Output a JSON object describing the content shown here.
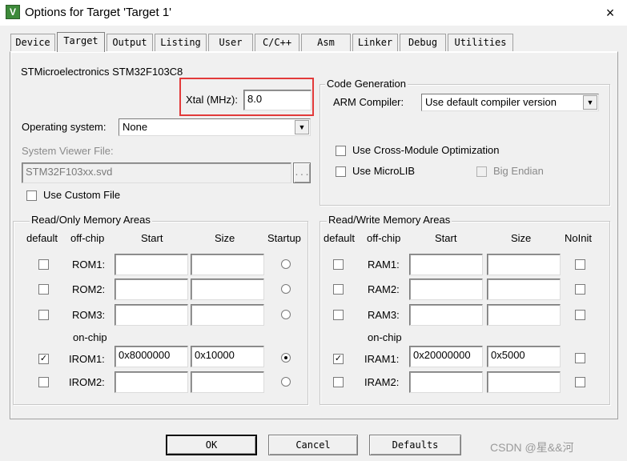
{
  "window": {
    "title": "Options for Target 'Target 1'",
    "app_icon_glyph": "V",
    "close_glyph": "×"
  },
  "tabs": [
    {
      "label": "Device",
      "active": false
    },
    {
      "label": "Target",
      "active": true
    },
    {
      "label": "Output",
      "active": false
    },
    {
      "label": "Listing",
      "active": false
    },
    {
      "label": "User",
      "active": false
    },
    {
      "label": "C/C++",
      "active": false
    },
    {
      "label": "Asm",
      "active": false
    },
    {
      "label": "Linker",
      "active": false
    },
    {
      "label": "Debug",
      "active": false
    },
    {
      "label": "Utilities",
      "active": false
    }
  ],
  "target": {
    "device_name": "STMicroelectronics STM32F103C8",
    "xtal_label": "Xtal (MHz):",
    "xtal_value": "8.0",
    "os_label": "Operating system:",
    "os_value": "None",
    "svd_label": "System Viewer File:",
    "svd_value": "STM32F103xx.svd",
    "browse_label": "...",
    "custom_file_label": "Use Custom File",
    "custom_file_checked": false
  },
  "code_generation": {
    "title": "Code Generation",
    "compiler_label": "ARM Compiler:",
    "compiler_value": "Use default compiler version",
    "cross_module_label": "Use Cross-Module Optimization",
    "cross_module_checked": false,
    "microlib_label": "Use MicroLIB",
    "microlib_checked": false,
    "big_endian_label": "Big Endian",
    "big_endian_checked": false
  },
  "ro_memory": {
    "title": "Read/Only Memory Areas",
    "headers": {
      "default": "default",
      "offchip": "off-chip",
      "start": "Start",
      "size": "Size",
      "startup": "Startup"
    },
    "onchip_label": "on-chip",
    "rows": [
      {
        "label": "ROM1:",
        "default": false,
        "start": "",
        "size": "",
        "startup": false
      },
      {
        "label": "ROM2:",
        "default": false,
        "start": "",
        "size": "",
        "startup": false
      },
      {
        "label": "ROM3:",
        "default": false,
        "start": "",
        "size": "",
        "startup": false
      },
      {
        "label": "IROM1:",
        "default": true,
        "start": "0x8000000",
        "size": "0x10000",
        "startup": true
      },
      {
        "label": "IROM2:",
        "default": false,
        "start": "",
        "size": "",
        "startup": false
      }
    ]
  },
  "rw_memory": {
    "title": "Read/Write Memory Areas",
    "headers": {
      "default": "default",
      "offchip": "off-chip",
      "start": "Start",
      "size": "Size",
      "noinit": "NoInit"
    },
    "onchip_label": "on-chip",
    "rows": [
      {
        "label": "RAM1:",
        "default": false,
        "start": "",
        "size": "",
        "noinit": false
      },
      {
        "label": "RAM2:",
        "default": false,
        "start": "",
        "size": "",
        "noinit": false
      },
      {
        "label": "RAM3:",
        "default": false,
        "start": "",
        "size": "",
        "noinit": false
      },
      {
        "label": "IRAM1:",
        "default": true,
        "start": "0x20000000",
        "size": "0x5000",
        "noinit": false
      },
      {
        "label": "IRAM2:",
        "default": false,
        "start": "",
        "size": "",
        "noinit": false
      }
    ]
  },
  "buttons": {
    "ok": "OK",
    "cancel": "Cancel",
    "defaults": "Defaults"
  },
  "watermark": "CSDN @星&&河",
  "check_glyph": "✓",
  "colors": {
    "highlight": "#e23a3a",
    "window_bg": "#f0f0f0"
  }
}
